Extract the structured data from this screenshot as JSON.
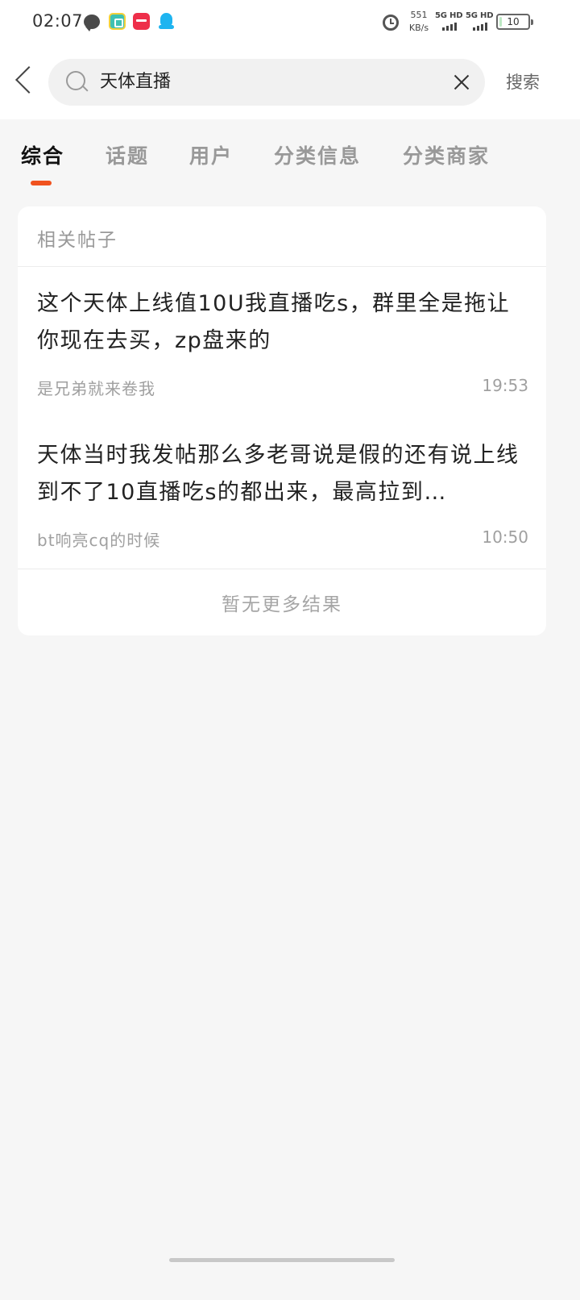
{
  "status_bar": {
    "time": "02:07",
    "speed_value": "551",
    "speed_unit": "KB/s",
    "network1": "5G HD",
    "network2": "5G HD",
    "battery_level": "10",
    "battery_fraction": 0.1
  },
  "search": {
    "query": "天体直播",
    "button_label": "搜索"
  },
  "tabs": [
    {
      "label": "综合",
      "active": true
    },
    {
      "label": "话题",
      "active": false
    },
    {
      "label": "用户",
      "active": false
    },
    {
      "label": "分类信息",
      "active": false
    },
    {
      "label": "分类商家",
      "active": false
    }
  ],
  "results": {
    "section_title": "相关帖子",
    "posts": [
      {
        "title": "这个天体上线值10U我直播吃s，群里全是拖让你现在去买，zp盘来的",
        "author": "是兄弟就来卷我",
        "time": "19:53"
      },
      {
        "title": "天体当时我发帖那么多老哥说是假的还有说上线到不了10直播吃s的都出来，最高拉到…",
        "author": "bt响亮cq的时候",
        "time": "10:50"
      }
    ],
    "no_more_label": "暂无更多结果"
  },
  "colors": {
    "accent": "#f0521e",
    "background": "#f6f6f6"
  }
}
